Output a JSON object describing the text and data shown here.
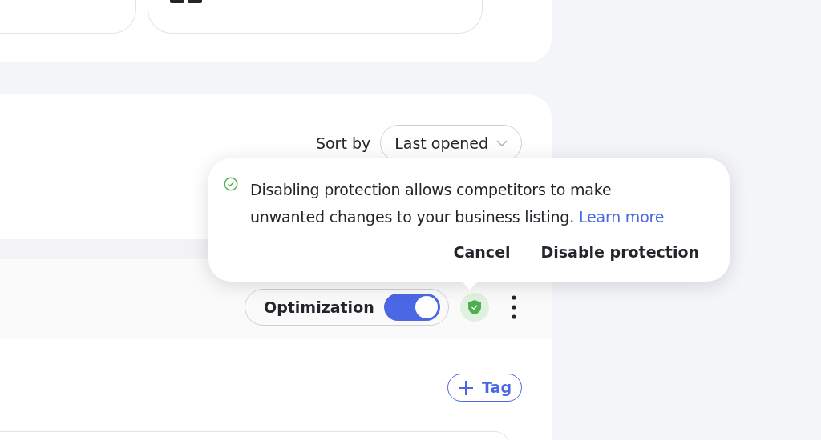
{
  "sort": {
    "label": "Sort by",
    "value": "Last opened"
  },
  "popover": {
    "message": "Disabling protection allows competitors to make unwanted changes to your business listing.",
    "link": "Learn more",
    "buttons": [
      {
        "label": "Cancel"
      },
      {
        "label": "Disable protection"
      }
    ]
  },
  "listing": {
    "optimization": {
      "label": "Optimization",
      "on": true
    },
    "protected": true,
    "tag_button": "Tag"
  }
}
